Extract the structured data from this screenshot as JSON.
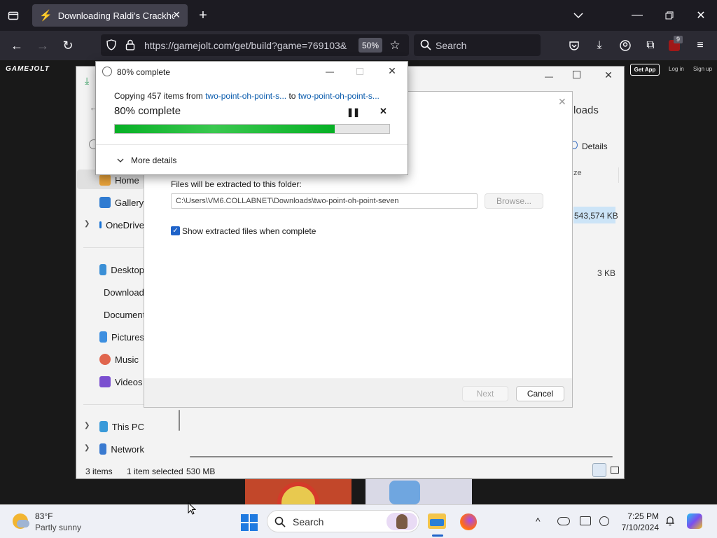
{
  "browser": {
    "tab_title": "Downloading Raldi's Crackhouse",
    "url": "https://gamejolt.com/get/build?game=769103&",
    "zoom": "50%",
    "search_placeholder": "Search",
    "ext_badge": "9"
  },
  "gamejolt": {
    "logo": "GAMEJOLT",
    "get_app": "Get App",
    "login": "Log in",
    "signup": "Sign up"
  },
  "explorer": {
    "header_fragment": "loads",
    "details_label": "Details",
    "column_size": "ze",
    "sizes": [
      "543,574 KB",
      "3 KB"
    ],
    "sidebar": [
      {
        "label": "Home",
        "color": "#e8a23a"
      },
      {
        "label": "Gallery",
        "color": "#2f7bd1"
      },
      {
        "label": "OneDrive",
        "color": "#1570d4"
      },
      {
        "label": "Desktop",
        "color": "#3a8fd6"
      },
      {
        "label": "Downloads",
        "color": "#2a9b5a"
      },
      {
        "label": "Documents",
        "color": "#8c8c9a"
      },
      {
        "label": "Pictures",
        "color": "#3d8fe0"
      },
      {
        "label": "Music",
        "color": "#e0654d"
      },
      {
        "label": "Videos",
        "color": "#7b4fd0"
      },
      {
        "label": "This PC",
        "color": "#3a9ad9"
      },
      {
        "label": "Network",
        "color": "#3a7ad0"
      }
    ],
    "status_items": "3 items",
    "status_selected": "1 item selected",
    "status_size": "530 MB"
  },
  "extract_dialog": {
    "folder_label": "Files will be extracted to this folder:",
    "folder_path": "C:\\Users\\VM6.COLLABNET\\Downloads\\two-point-oh-point-seven",
    "browse_label": "Browse...",
    "show_files_label": "Show extracted files when complete",
    "show_files_checked": true,
    "next_label": "Next",
    "cancel_label": "Cancel"
  },
  "copy_dialog": {
    "title": "80% complete",
    "copying_prefix": "Copying 457 items from ",
    "source": "two-point-oh-point-s...",
    "to_word": " to ",
    "dest": "two-point-oh-point-s...",
    "status": "80% complete",
    "progress": 0.8,
    "more_details": "More details"
  },
  "taskbar": {
    "temp": "83°F",
    "weather": "Partly sunny",
    "search": "Search",
    "time": "7:25 PM",
    "date": "7/10/2024"
  }
}
